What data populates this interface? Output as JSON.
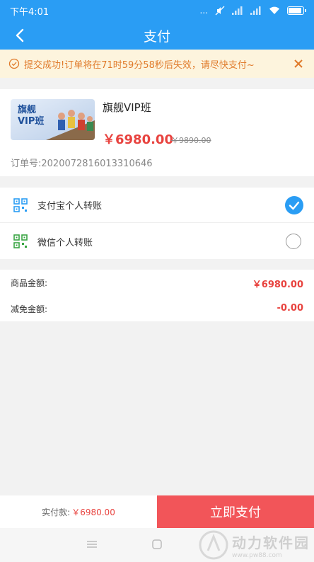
{
  "status_bar": {
    "time": "下午4:01",
    "signal_dots": "..."
  },
  "header": {
    "title": "支付"
  },
  "notice": {
    "text": "提交成功!订单将在71时59分58秒后失效，请尽快支付~"
  },
  "product": {
    "thumb_text_line1": "旗舰",
    "thumb_text_line2": "VIP班",
    "name": "旗舰VIP班",
    "price": "￥6980.00",
    "original_price": "￥9890.00",
    "order_number": "订单号:2020072816013310646"
  },
  "payment_methods": [
    {
      "label": "支付宝个人转账",
      "selected": true
    },
    {
      "label": "微信个人转账",
      "selected": false
    }
  ],
  "amounts": {
    "goods_label": "商品金额:",
    "goods_value": "￥6980.00",
    "discount_label": "减免金额:",
    "discount_value": "-0.00"
  },
  "bottom_bar": {
    "total_label": "实付款:",
    "total_value": "￥6980.00",
    "pay_button": "立即支付"
  },
  "watermark": {
    "title": "动力软件园",
    "url": "www.pw88.com"
  },
  "colors": {
    "primary": "#2a9df4",
    "accent_red": "#e8433f",
    "pay_button": "#f25559",
    "notice_bg": "#fdf4dd",
    "notice_text": "#e07a2a"
  }
}
